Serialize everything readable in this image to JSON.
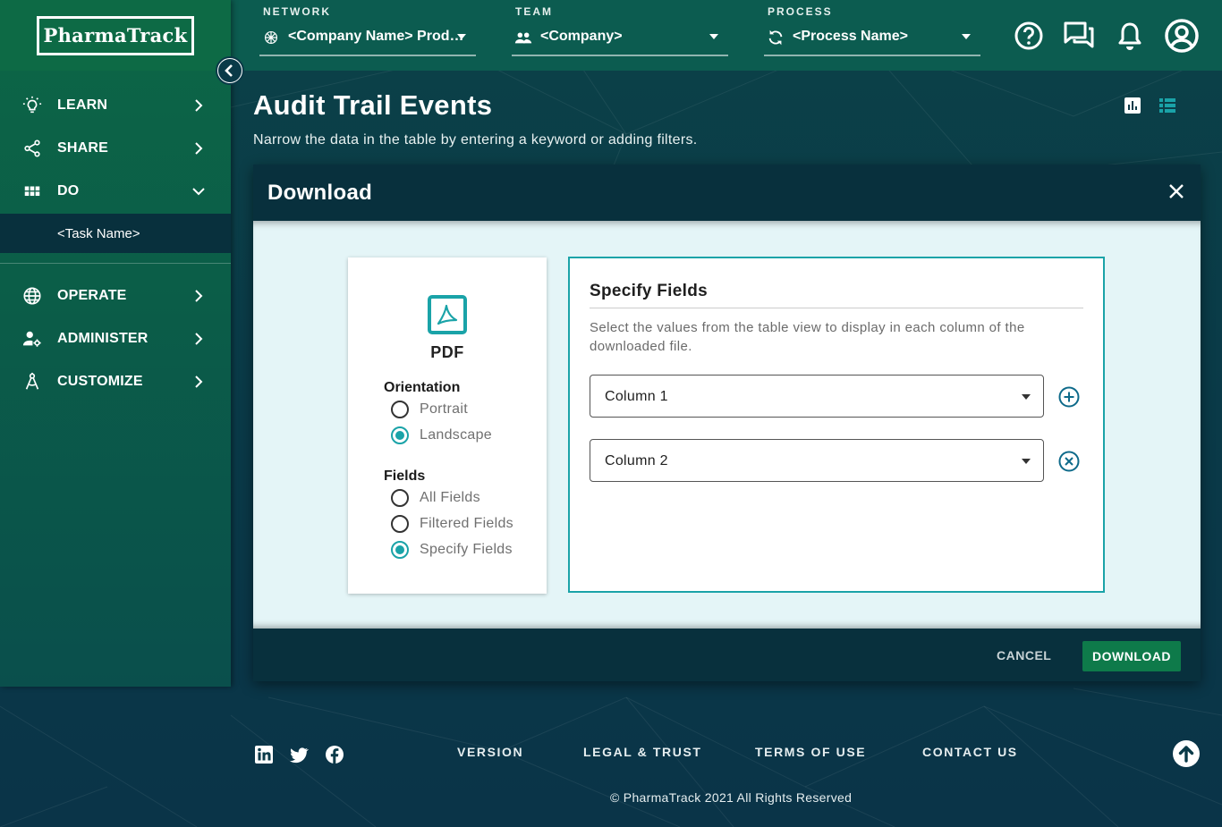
{
  "app": {
    "logo": "PharmaTrack"
  },
  "topbar": {
    "network": {
      "caption": "NETWORK",
      "value": "<Company Name> Prod…"
    },
    "team": {
      "caption": "TEAM",
      "value": "<Company>"
    },
    "process": {
      "caption": "PROCESS",
      "value": "<Process Name>"
    },
    "icons": [
      "help-icon",
      "chat-icon",
      "bell-icon",
      "account-icon"
    ]
  },
  "sidebar": {
    "items": [
      {
        "label": "LEARN",
        "icon": "lightbulb-icon"
      },
      {
        "label": "SHARE",
        "icon": "share-icon"
      },
      {
        "label": "DO",
        "icon": "grid-icon",
        "expanded": true
      },
      {
        "label": "OPERATE",
        "icon": "globe-icon"
      },
      {
        "label": "ADMINISTER",
        "icon": "user-gear-icon"
      },
      {
        "label": "CUSTOMIZE",
        "icon": "compass-icon"
      }
    ],
    "sub_item": "<Task Name>"
  },
  "page": {
    "title": "Audit Trail Events",
    "subtitle": "Narrow the data in the table by entering a keyword or adding filters."
  },
  "modal": {
    "title": "Download",
    "format": {
      "label": "PDF",
      "icon": "pdf-icon"
    },
    "orientation": {
      "label": "Orientation",
      "options": [
        "Portrait",
        "Landscape"
      ],
      "selected": "Landscape"
    },
    "fields": {
      "label": "Fields",
      "options": [
        "All Fields",
        "Filtered Fields",
        "Specify Fields"
      ],
      "selected": "Specify Fields"
    },
    "specify": {
      "title": "Specify Fields",
      "description": "Select the values from the table view to display in each column of the downloaded file.",
      "columns": [
        "Column 1",
        "Column 2"
      ]
    },
    "cancel_label": "CANCEL",
    "download_label": "DOWNLOAD"
  },
  "footer": {
    "social": [
      "linkedin-icon",
      "twitter-icon",
      "facebook-icon"
    ],
    "links": [
      "VERSION",
      "LEGAL & TRUST",
      "TERMS OF USE",
      "CONTACT US"
    ],
    "copyright": "© PharmaTrack 2021 All Rights Reserved"
  },
  "colors": {
    "accent": "#1aa3a8",
    "primary_green": "#0e7a4a",
    "dark": "#08303d"
  }
}
